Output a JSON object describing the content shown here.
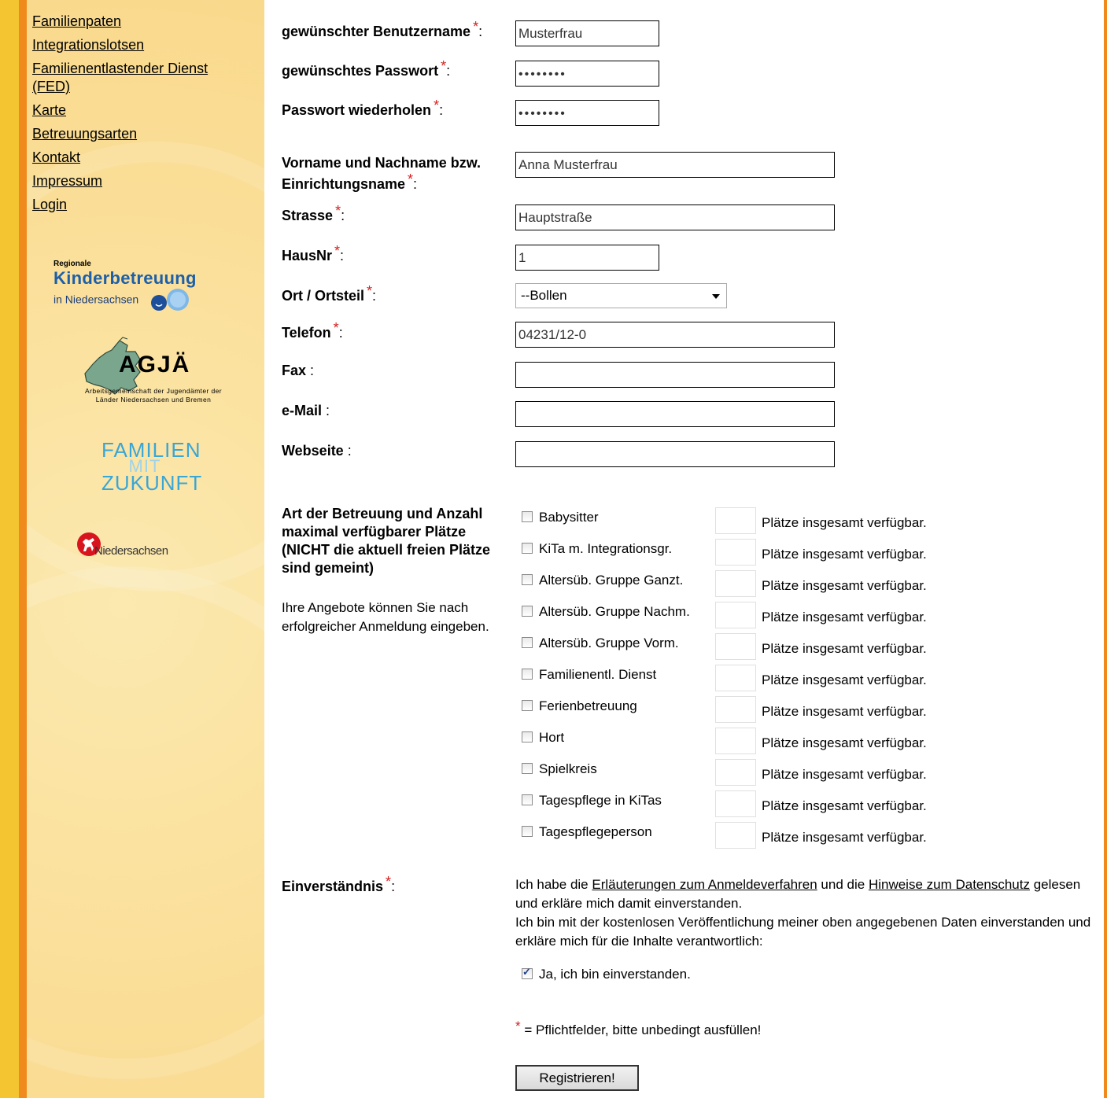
{
  "nav": {
    "items": [
      "Familienpaten",
      "Integrationslotsen",
      "Familienentlastender Dienst (FED)",
      "Karte",
      "Betreuungsarten",
      "Kontakt",
      "Impressum",
      "Login"
    ]
  },
  "logos": {
    "kb_small": "Regionale",
    "kb_big": "Kinderbetreuung",
    "kb_sub": "in Niedersachsen",
    "agja": "AGJÄ",
    "agja_sub": "Arbeitsgemeinschaft der Jugendämter der Länder Niedersachsen und Bremen",
    "fmz_1": "FAMILIEN",
    "fmz_2": "MIT",
    "fmz_3": "ZUKUNFT",
    "nds": "Niedersachsen"
  },
  "form": {
    "star": "*",
    "colon": ":",
    "username": {
      "label": "gewünschter Benutzername",
      "value": "Musterfrau"
    },
    "password": {
      "label": "gewünschtes Passwort",
      "value": "••••••••"
    },
    "password_repeat": {
      "label": "Passwort wiederholen",
      "value": "••••••••"
    },
    "name": {
      "label": "Vorname und Nachname bzw. Einrichtungsname",
      "value": "Anna Musterfrau"
    },
    "street": {
      "label": "Strasse",
      "value": "Hauptstraße"
    },
    "house_no": {
      "label": "HausNr",
      "value": "1"
    },
    "city": {
      "label": "Ort / Ortsteil",
      "value": "--Bollen"
    },
    "phone": {
      "label": "Telefon",
      "value": "04231/12-0"
    },
    "fax": {
      "label": "Fax",
      "value": ""
    },
    "email": {
      "label": "e-Mail",
      "value": ""
    },
    "website": {
      "label": "Webseite",
      "value": ""
    }
  },
  "care": {
    "title": "Art der Betreuung und Anzahl maximal verfügbarer Plätze (NICHT die aktuell freien Plätze sind gemeint)",
    "note": "Ihre Angebote können Sie nach erfolgreicher Anmeldung eingeben.",
    "places_text": "Plätze insgesamt verfügbar.",
    "types": [
      "Babysitter",
      "KiTa m. Integrationsgr.",
      "Altersüb. Gruppe Ganzt.",
      "Altersüb. Gruppe Nachm.",
      "Altersüb. Gruppe Vorm.",
      "Familienentl. Dienst",
      "Ferienbetreuung",
      "Hort",
      "Spielkreis",
      "Tagespflege in KiTas",
      "Tagespflegeperson"
    ]
  },
  "consent": {
    "label": "Einverständnis",
    "text_1": "Ich habe die ",
    "link_1": "Erläuterungen zum Anmeldeverfahren",
    "text_2": " und die ",
    "link_2": "Hinweise zum Datenschutz",
    "text_3": " gelesen und erkläre mich damit einverstanden.",
    "text_4": "Ich bin mit der kostenlosen Veröffentlichung meiner oben angegebenen Daten einverstanden und erkläre mich für die Inhalte verantwortlich:",
    "checkbox_label": "Ja, ich bin einverstanden.",
    "checked": true
  },
  "footnote": "= Pflichtfelder, bitte unbedingt ausfüllen!",
  "submit_label": "Registrieren!"
}
